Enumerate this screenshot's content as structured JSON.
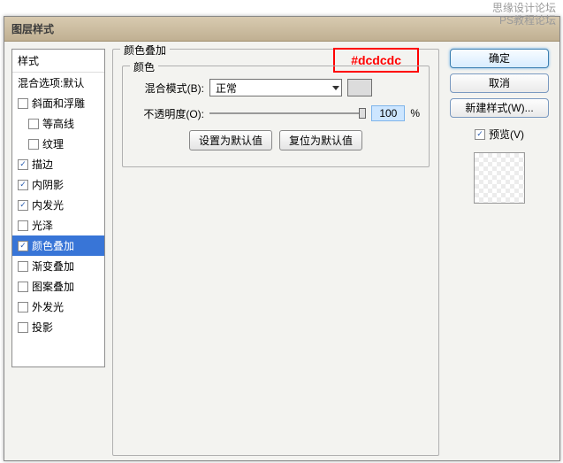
{
  "watermark": {
    "line1": "思缘设计论坛",
    "line2": "PS教程论坛"
  },
  "dialog": {
    "title": "图层样式"
  },
  "styles": {
    "header": "样式",
    "blendOptions": "混合选项:默认",
    "items": [
      {
        "label": "斜面和浮雕",
        "checked": false
      },
      {
        "label": "等高线",
        "checked": false,
        "indent": true
      },
      {
        "label": "纹理",
        "checked": false,
        "indent": true
      },
      {
        "label": "描边",
        "checked": true
      },
      {
        "label": "内阴影",
        "checked": true
      },
      {
        "label": "内发光",
        "checked": true
      },
      {
        "label": "光泽",
        "checked": false
      },
      {
        "label": "颜色叠加",
        "checked": true,
        "selected": true
      },
      {
        "label": "渐变叠加",
        "checked": false
      },
      {
        "label": "图案叠加",
        "checked": false
      },
      {
        "label": "外发光",
        "checked": false
      },
      {
        "label": "投影",
        "checked": false
      }
    ]
  },
  "main": {
    "title": "颜色叠加",
    "innerTitle": "颜色",
    "blendModeLabel": "混合模式(B):",
    "blendModeValue": "正常",
    "opacityLabel": "不透明度(O):",
    "opacityValue": "100",
    "opacityUnit": "%",
    "defaultBtn": "设置为默认值",
    "resetBtn": "复位为默认值",
    "annotation": "#dcdcdc"
  },
  "right": {
    "ok": "确定",
    "cancel": "取消",
    "newStyle": "新建样式(W)...",
    "preview": "预览(V)"
  }
}
